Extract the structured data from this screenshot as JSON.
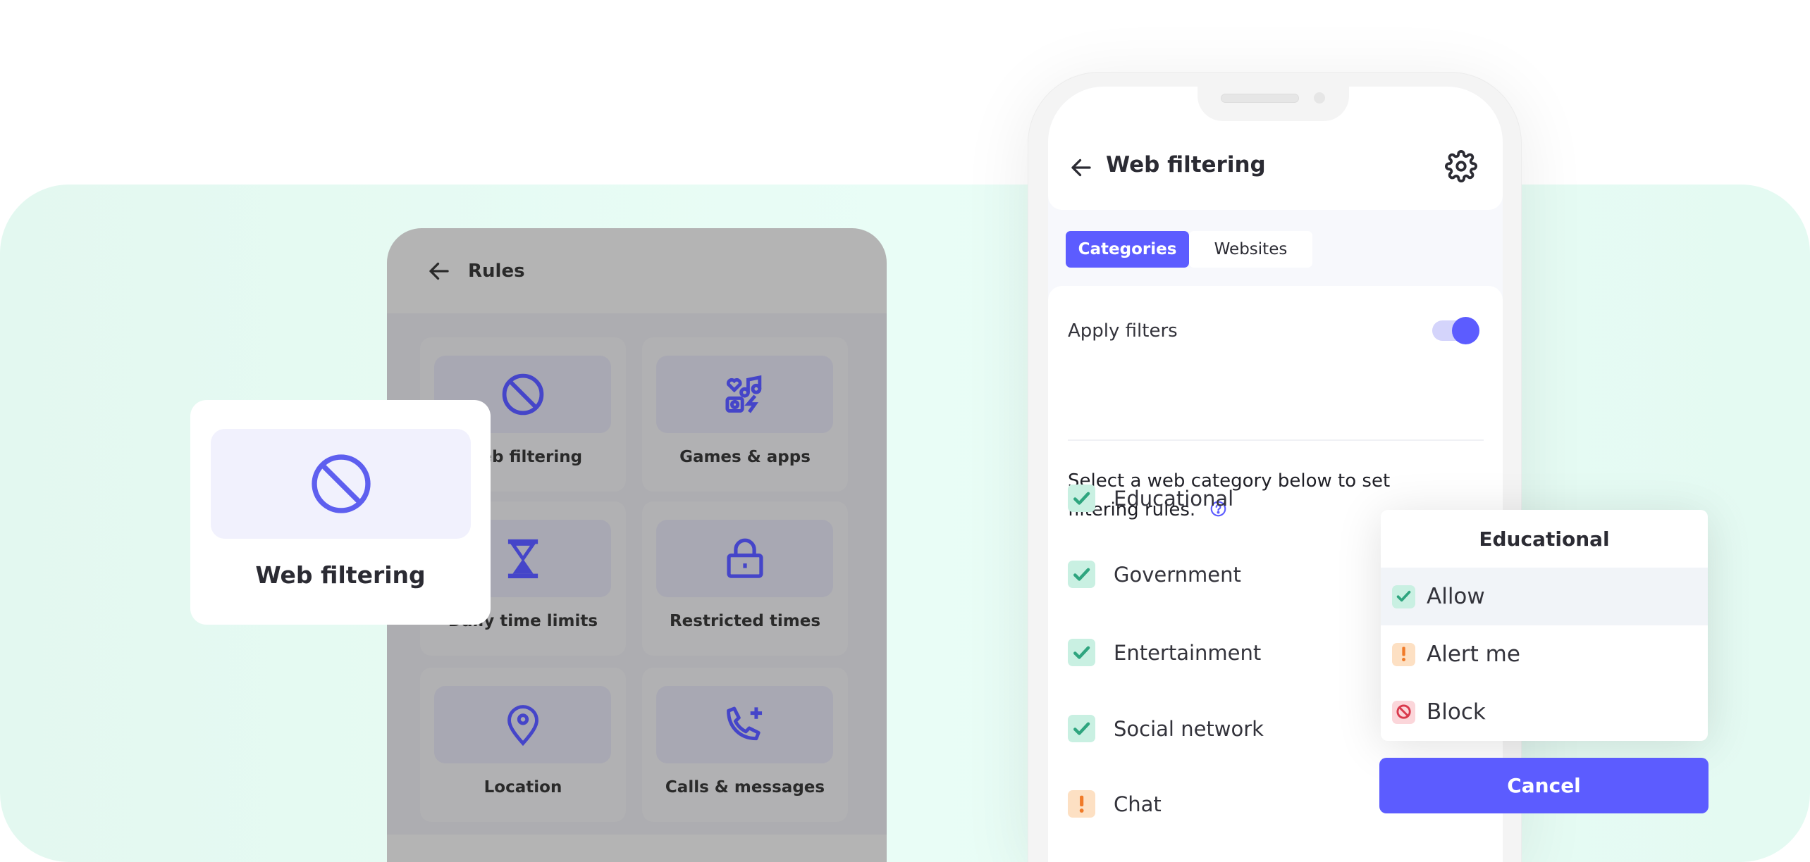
{
  "colors": {
    "accent": "#5c5cff",
    "icon": "#4545c9",
    "allow": "#2fa57f",
    "alert": "#f07a28",
    "block": "#d9394c",
    "mint": "#e7fbf4"
  },
  "rules_screen": {
    "title": "Rules",
    "items": [
      {
        "label": "Web filtering",
        "icon": "block-icon"
      },
      {
        "label": "Games & apps",
        "icon": "games-apps-icon"
      },
      {
        "label": "Daily time limits",
        "icon": "hourglass-icon"
      },
      {
        "label": "Restricted times",
        "icon": "lock-icon"
      },
      {
        "label": "Location",
        "icon": "location-pin-icon"
      },
      {
        "label": "Calls & messages",
        "icon": "phone-plus-icon"
      }
    ]
  },
  "highlight_card": {
    "label": "Web filtering",
    "icon": "block-icon"
  },
  "phone": {
    "title": "Web filtering",
    "tabs": [
      {
        "label": "Categories",
        "active": true
      },
      {
        "label": "Websites",
        "active": false
      }
    ],
    "apply_filters": {
      "label": "Apply filters",
      "on": true
    },
    "description": "Select a web category below to set filtering rules.",
    "categories": [
      {
        "label": "Educational",
        "status": "allow"
      },
      {
        "label": "Government",
        "status": "allow"
      },
      {
        "label": "Entertainment",
        "status": "allow"
      },
      {
        "label": "Social network",
        "status": "allow"
      },
      {
        "label": "Chat",
        "status": "alert"
      }
    ]
  },
  "popup": {
    "title": "Educational",
    "options": [
      {
        "label": "Allow",
        "status": "allow",
        "selected": true
      },
      {
        "label": "Alert me",
        "status": "alert",
        "selected": false
      },
      {
        "label": "Block",
        "status": "block",
        "selected": false
      }
    ],
    "cancel_label": "Cancel"
  }
}
